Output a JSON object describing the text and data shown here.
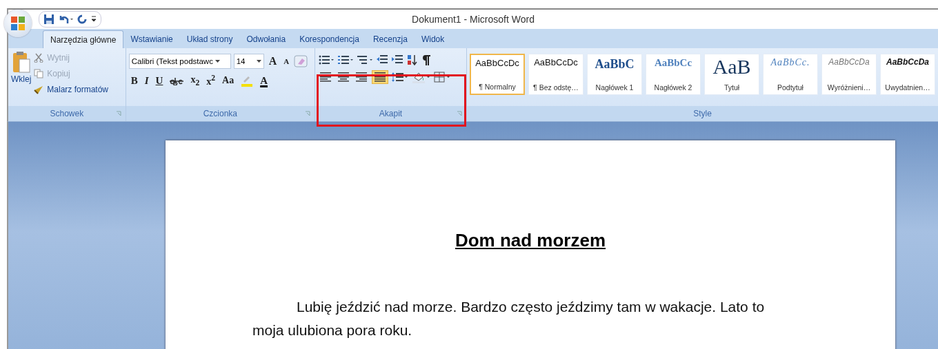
{
  "window": {
    "title": "Dokument1 - Microsoft Word"
  },
  "tabs": [
    {
      "label": "Narzędzia główne",
      "selected": true
    },
    {
      "label": "Wstawianie",
      "selected": false
    },
    {
      "label": "Układ strony",
      "selected": false
    },
    {
      "label": "Odwołania",
      "selected": false
    },
    {
      "label": "Korespondencja",
      "selected": false
    },
    {
      "label": "Recenzja",
      "selected": false
    },
    {
      "label": "Widok",
      "selected": false
    }
  ],
  "clipboard": {
    "label": "Schowek",
    "paste": "Wklej",
    "commands": [
      {
        "label": "Wytnij",
        "kind": "cut",
        "disabled": true
      },
      {
        "label": "Kopiuj",
        "kind": "copy",
        "disabled": true
      },
      {
        "label": "Malarz formatów",
        "kind": "brush",
        "disabled": false
      }
    ]
  },
  "font": {
    "label": "Czcionka",
    "name": "Calibri (Tekst podstawc",
    "size": "14",
    "grow": "A",
    "shrink": "A",
    "format": [
      {
        "kind": "bold",
        "label": "B"
      },
      {
        "kind": "italic",
        "label": "I"
      },
      {
        "kind": "underline",
        "label": "U"
      },
      {
        "kind": "strike"
      },
      {
        "kind": "sub",
        "label": "x$_{2}$"
      },
      {
        "kind": "sup",
        "label": "x$^{2}$"
      },
      {
        "kind": "case",
        "label": "Aa"
      },
      {
        "kind": "highlight"
      },
      {
        "kind": "color",
        "label": "A"
      }
    ]
  },
  "paragraph": {
    "label": "Akapit",
    "highlighted": true,
    "align": [
      {
        "kind": "left",
        "selected": false
      },
      {
        "kind": "center",
        "selected": false
      },
      {
        "kind": "right",
        "selected": false
      },
      {
        "kind": "justify",
        "selected": true
      }
    ]
  },
  "styles": {
    "label": "Style",
    "items": [
      {
        "sample": "AaBbCcDc",
        "name": "¶ Normalny",
        "kind": "normal",
        "selected": true
      },
      {
        "sample": "AaBbCcDc",
        "name": "¶ Bez odstę…",
        "kind": "normal",
        "selected": false
      },
      {
        "sample": "AaBbC",
        "name": "Nagłówek 1",
        "kind": "heading1",
        "selected": false
      },
      {
        "sample": "AaBbCc",
        "name": "Nagłówek 2",
        "kind": "heading2",
        "selected": false
      },
      {
        "sample": "AaB",
        "name": "Tytuł",
        "kind": "title",
        "selected": false
      },
      {
        "sample": "AaBbCc.",
        "name": "Podtytuł",
        "kind": "subtitle",
        "selected": false
      },
      {
        "sample": "AaBbCcDa",
        "name": "Wyróżnieni…",
        "kind": "subtle",
        "selected": false
      },
      {
        "sample": "AaBbCcDa",
        "name": "Uwydatnien…",
        "kind": "intense",
        "selected": false
      }
    ]
  },
  "document": {
    "title": "Dom nad morzem",
    "paragraph": "Lubię jeździć nad morze. Bardzo często jeździmy tam w wakacje. Lato to moja ulubiona pora roku."
  }
}
